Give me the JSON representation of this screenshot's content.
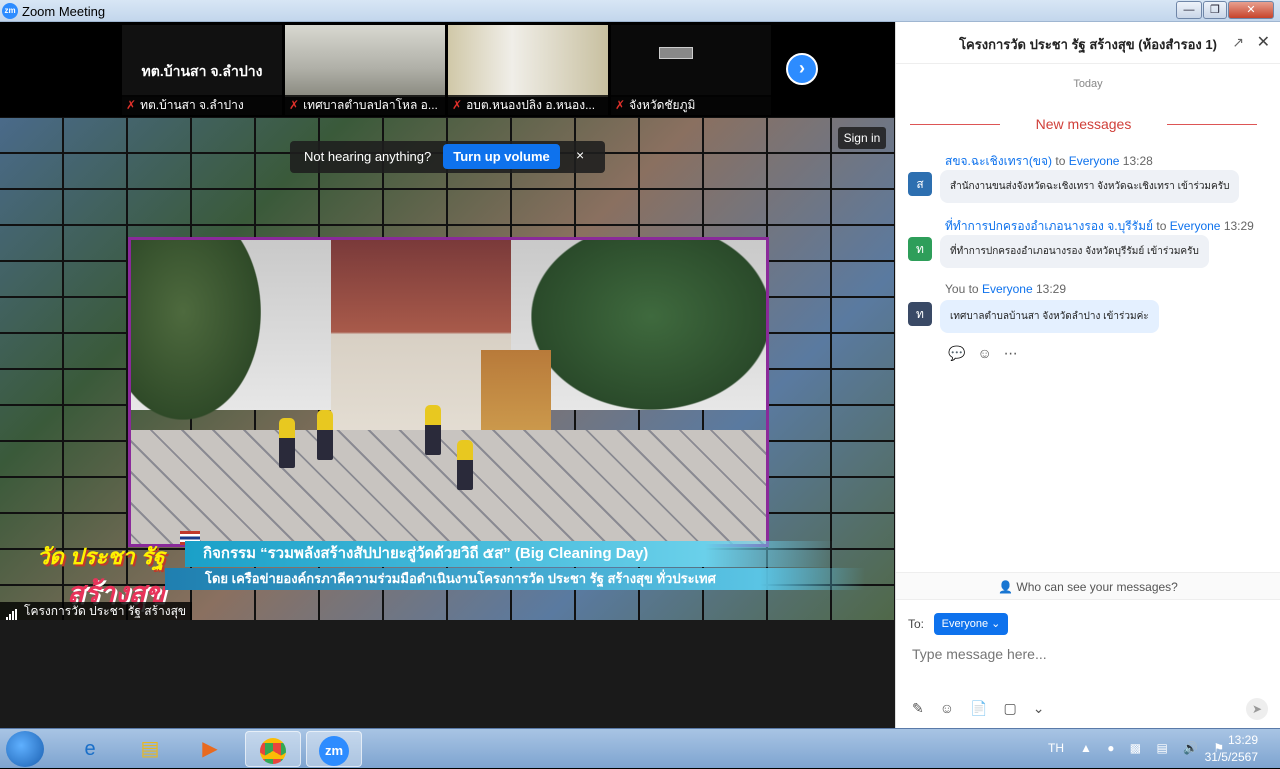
{
  "window": {
    "title": "Zoom Meeting",
    "app_icon": "zm"
  },
  "thumbs": [
    {
      "main": "ทต.บ้านสา จ.ลำปาง",
      "label": "ทต.บ้านสา จ.ลำปาง"
    },
    {
      "label": "เทศบาลตำบลปลาโหล อ..."
    },
    {
      "label": "อบต.หนองปลิง อ.หนอง..."
    },
    {
      "label": "จังหวัดชัยภูมิ"
    }
  ],
  "notice": {
    "text": "Not hearing anything?",
    "button": "Turn up volume",
    "close": "×"
  },
  "signin": "Sign in",
  "banner": {
    "logo_line1": "วัด ประชา รัฐ",
    "logo_line2": "สร้างสุข",
    "line1": "กิจกรรม “รวมพลังสร้างสัปปายะสู่วัดด้วยวิถี ๕ส” (Big Cleaning Day)",
    "line2": "โดย เครือข่ายองค์กรภาคีความร่วมมือดำเนินงานโครงการวัด ประชา รัฐ สร้างสุข ทั่วประเทศ"
  },
  "video_label": "โครงการวัด ประชา รัฐ สร้างสุข",
  "chat": {
    "title": "โครงการวัด ประชา รัฐ สร้างสุข (ห้องสำรอง 1)",
    "today": "Today",
    "new_messages": "New messages",
    "messages": [
      {
        "avatar": "ส",
        "color": "#2d6fb0",
        "sender": "สขจ.ฉะเชิงเทรา(ขจ)",
        "to": "to",
        "recipient": "Everyone",
        "time": "13:28",
        "text": "สำนักงานขนส่งจังหวัดฉะเชิงเทรา จังหวัดฉะเชิงเทรา เข้าร่วมครับ"
      },
      {
        "avatar": "ท",
        "color": "#2e9e5a",
        "sender": "ที่ทำการปกครองอำเภอนางรอง จ.บุรีรัมย์",
        "to": "to",
        "recipient": "Everyone",
        "time": "13:29",
        "text": "ที่ทำการปกครองอำเภอนางรอง จังหวัดบุรีรัมย์ เข้าร่วมครับ"
      },
      {
        "avatar": "ท",
        "color": "#3a4a66",
        "sender": "You",
        "to": "to",
        "recipient": "Everyone",
        "time": "13:29",
        "text": "เทศบาลตำบลบ้านสา จังหวัดลำปาง เข้าร่วมค่ะ"
      }
    ],
    "who_can_see": "Who can see your messages?",
    "to_label": "To:",
    "to_value": "Everyone",
    "input_placeholder": "Type message here..."
  },
  "taskbar": {
    "lang": "TH",
    "time": "13:29",
    "date": "31/5/2567",
    "zoom_icon": "zm"
  }
}
